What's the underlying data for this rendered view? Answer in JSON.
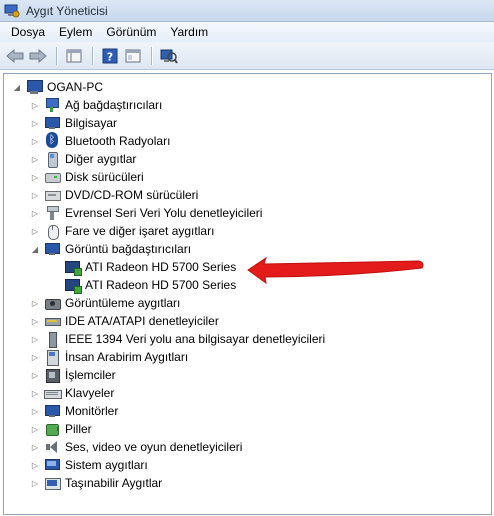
{
  "window": {
    "title": "Aygıt Yöneticisi"
  },
  "menu": [
    "Dosya",
    "Eylem",
    "Görünüm",
    "Yardım"
  ],
  "toolbar": {
    "buttons": [
      {
        "icon": "back-arrow-icon"
      },
      {
        "icon": "forward-arrow-icon"
      },
      {
        "icon": "properties-grid-icon"
      },
      {
        "icon": "help-icon"
      },
      {
        "icon": "show-hide-pane-icon"
      },
      {
        "icon": "scan-hardware-icon"
      }
    ]
  },
  "tree": {
    "root": {
      "label": "OGAN-PC",
      "expanded": true
    },
    "categories": [
      {
        "label": "Ağ bağdaştırıcıları",
        "icon": "network-adapter-icon",
        "expanded": false
      },
      {
        "label": "Bilgisayar",
        "icon": "computer-icon",
        "expanded": false
      },
      {
        "label": "Bluetooth Radyoları",
        "icon": "bluetooth-icon",
        "expanded": false
      },
      {
        "label": "Diğer aygıtlar",
        "icon": "other-device-icon",
        "expanded": false
      },
      {
        "label": "Disk sürücüleri",
        "icon": "disk-drive-icon",
        "expanded": false
      },
      {
        "label": "DVD/CD-ROM sürücüleri",
        "icon": "dvd-drive-icon",
        "expanded": false
      },
      {
        "label": "Evrensel Seri Veri Yolu denetleyicileri",
        "icon": "usb-icon",
        "expanded": false
      },
      {
        "label": "Fare ve diğer işaret aygıtları",
        "icon": "mouse-icon",
        "expanded": false
      },
      {
        "label": "Görüntü bağdaştırıcıları",
        "icon": "display-adapter-icon",
        "expanded": true,
        "children": [
          {
            "label": "ATI Radeon HD 5700 Series",
            "icon": "display-adapter-icon"
          },
          {
            "label": "ATI Radeon HD 5700 Series",
            "icon": "display-adapter-icon"
          }
        ]
      },
      {
        "label": "Görüntüleme aygıtları",
        "icon": "imaging-device-icon",
        "expanded": false
      },
      {
        "label": "IDE ATA/ATAPI denetleyiciler",
        "icon": "ide-controller-icon",
        "expanded": false
      },
      {
        "label": "IEEE 1394 Veri yolu ana bilgisayar denetleyicileri",
        "icon": "ieee1394-icon",
        "expanded": false
      },
      {
        "label": "İnsan Arabirim Aygıtları",
        "icon": "hid-icon",
        "expanded": false
      },
      {
        "label": "İşlemciler",
        "icon": "processor-icon",
        "expanded": false
      },
      {
        "label": "Klavyeler",
        "icon": "keyboard-icon",
        "expanded": false
      },
      {
        "label": "Monitörler",
        "icon": "monitor-icon",
        "expanded": false
      },
      {
        "label": "Piller",
        "icon": "battery-icon",
        "expanded": false
      },
      {
        "label": "Ses, video ve oyun denetleyicileri",
        "icon": "sound-icon",
        "expanded": false
      },
      {
        "label": "Sistem aygıtları",
        "icon": "system-device-icon",
        "expanded": false
      },
      {
        "label": "Taşınabilir Aygıtlar",
        "icon": "portable-device-icon",
        "expanded": false
      }
    ]
  },
  "annotation": {
    "color": "#e31b1b",
    "target": "ATI Radeon HD 5700 Series"
  }
}
